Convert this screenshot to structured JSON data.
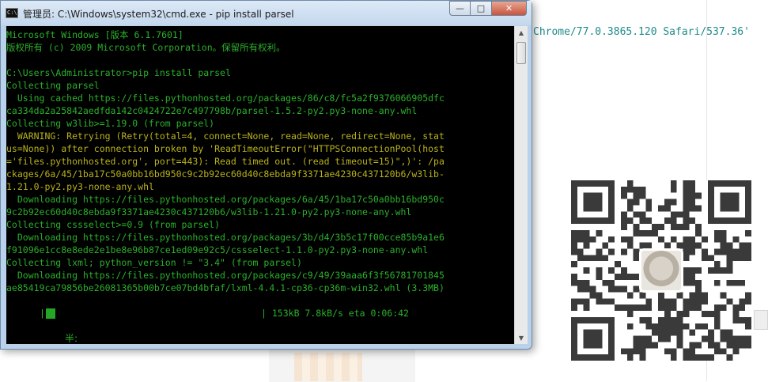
{
  "window": {
    "title": "管理员: C:\\Windows\\system32\\cmd.exe - pip  install parsel",
    "icon_text": "C:\\",
    "controls": {
      "minimize": "—",
      "maximize": "□",
      "close": "✕"
    }
  },
  "console": {
    "lines": [
      {
        "text": "Microsoft Windows [版本 6.1.7601]",
        "color": "green"
      },
      {
        "text": "版权所有 (c) 2009 Microsoft Corporation。保留所有权利。",
        "color": "green"
      },
      {
        "text": "",
        "color": "green"
      },
      {
        "text": "C:\\Users\\Administrator>pip install parsel",
        "color": "green"
      },
      {
        "text": "Collecting parsel",
        "color": "green"
      },
      {
        "text": "  Using cached https://files.pythonhosted.org/packages/86/c8/fc5a2f9376066905dfc",
        "color": "green"
      },
      {
        "text": "ca334da2a25842aedfda142c0424722e7c497798b/parsel-1.5.2-py2.py3-none-any.whl",
        "color": "green"
      },
      {
        "text": "Collecting w3lib>=1.19.0 (from parsel)",
        "color": "green"
      },
      {
        "text": "  WARNING: Retrying (Retry(total=4, connect=None, read=None, redirect=None, stat",
        "color": "yellow"
      },
      {
        "text": "us=None)) after connection broken by 'ReadTimeoutError(\"HTTPSConnectionPool(host",
        "color": "yellow"
      },
      {
        "text": "='files.pythonhosted.org', port=443): Read timed out. (read timeout=15)\",)': /pa",
        "color": "yellow"
      },
      {
        "text": "ckages/6a/45/1ba17c50a0bb16bd950c9c2b92ec60d40c8ebda9f3371ae4230c437120b6/w3lib-",
        "color": "yellow"
      },
      {
        "text": "1.21.0-py2.py3-none-any.whl",
        "color": "yellow"
      },
      {
        "text": "  Downloading https://files.pythonhosted.org/packages/6a/45/1ba17c50a0bb16bd950c",
        "color": "green"
      },
      {
        "text": "9c2b92ec60d40c8ebda9f3371ae4230c437120b6/w3lib-1.21.0-py2.py3-none-any.whl",
        "color": "green"
      },
      {
        "text": "Collecting cssselect>=0.9 (from parsel)",
        "color": "green"
      },
      {
        "text": "  Downloading https://files.pythonhosted.org/packages/3b/d4/3b5c17f00cce85b9a1e6",
        "color": "green"
      },
      {
        "text": "f91096e1cc8e8ede2e1be8e96b87ce1ed09e92c5/cssselect-1.1.0-py2.py3-none-any.whl",
        "color": "green"
      },
      {
        "text": "Collecting lxml; python_version != \"3.4\" (from parsel)",
        "color": "green"
      },
      {
        "text": "  Downloading https://files.pythonhosted.org/packages/c9/49/39aaa6f3f56781701845",
        "color": "green"
      },
      {
        "text": "ae85419ca79856be26081365b00b7ce07bd4bfaf/lxml-4.4.1-cp36-cp36m-win32.whl (3.3MB)",
        "color": "green"
      }
    ],
    "progress": {
      "left_bar": "|",
      "fraction": 0.046,
      "right_bar": "|",
      "stats": "153kB 7.8kB/s eta 0:06:42"
    },
    "ime_status": "半:"
  },
  "background": {
    "code_snippet": "Chrome/77.0.3865.120 Safari/537.36'"
  },
  "colors": {
    "console_bg": "#000000",
    "console_green": "#2bb02b",
    "console_yellow": "#b9b21c",
    "code_teal": "#1e8a8a",
    "close_red": "#c75540"
  }
}
